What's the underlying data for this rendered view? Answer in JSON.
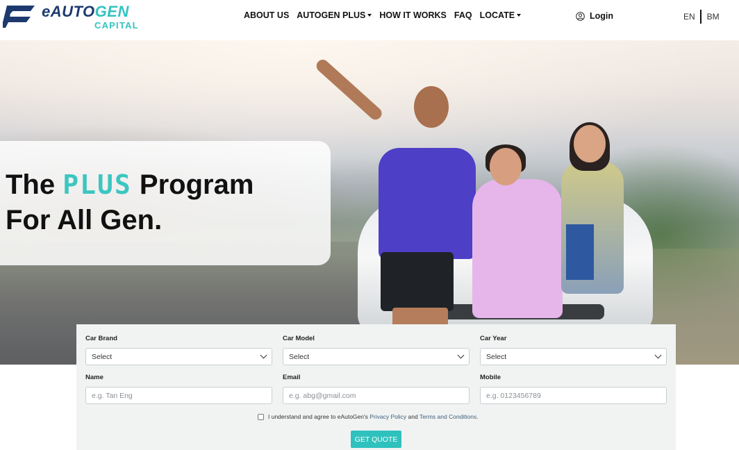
{
  "brand": {
    "name_primary": "eAUTO",
    "name_accent": "GEN",
    "sub": "CAPITAL",
    "logo_icon": "e-logo-icon",
    "color_navy": "#1d3a6e",
    "color_teal": "#33c3c0"
  },
  "nav": {
    "items": [
      {
        "label": "ABOUT US",
        "dropdown": false
      },
      {
        "label": "AUTOGEN PLUS",
        "dropdown": true
      },
      {
        "label": "HOW IT WORKS",
        "dropdown": false
      },
      {
        "label": "FAQ",
        "dropdown": false
      },
      {
        "label": "LOCATE",
        "dropdown": true
      }
    ],
    "login_label": "Login",
    "login_icon": "user-circle-icon",
    "languages": [
      "EN",
      "BM"
    ]
  },
  "hero": {
    "title_prefix": "The",
    "title_highlight": "PLUS",
    "title_suffix": "Program",
    "title_line2": "For All Gen."
  },
  "form": {
    "car_brand": {
      "label": "Car Brand",
      "value": "Select"
    },
    "car_model": {
      "label": "Car Model",
      "value": "Select"
    },
    "car_year": {
      "label": "Car Year",
      "value": "Select"
    },
    "name": {
      "label": "Name",
      "placeholder": "e.g. Tan Eng"
    },
    "email": {
      "label": "Email",
      "placeholder": "e.g. abg@gmail.com"
    },
    "mobile": {
      "label": "Mobile",
      "placeholder": "e.g. 0123456789"
    },
    "agree_text_1": "I understand and agree to eAutoGen's ",
    "agree_link_privacy": "Privacy Policy",
    "agree_text_2": " and ",
    "agree_link_terms": "Terms and Conditions",
    "agree_text_3": ".",
    "agree_checked": false,
    "submit_label": "GET QUOTE",
    "accent_color": "#2fc1bd"
  }
}
